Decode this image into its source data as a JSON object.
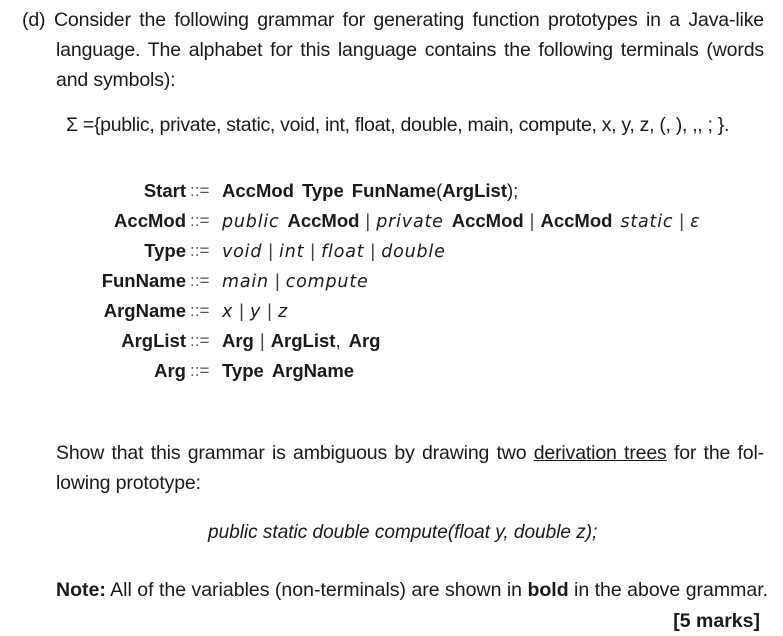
{
  "question": {
    "label": "(d)",
    "intro_lines": [
      "Consider the following grammar for generating function prototypes in a Java-like",
      "language.  The alphabet for this language contains the following terminals (words",
      "and symbols):"
    ],
    "alphabet": "Σ ={public, private, static, void, int, float, double, main, compute, x, y, z,  (,  ),  ,,  ;  }.",
    "grammar": {
      "operator": "::=",
      "rules": [
        {
          "lhs": "Start",
          "rhs": [
            {
              "text": "AccMod",
              "kind": "nt"
            },
            {
              "text": " ",
              "kind": "sp"
            },
            {
              "text": "Type",
              "kind": "nt"
            },
            {
              "text": " ",
              "kind": "sp"
            },
            {
              "text": "FunName",
              "kind": "nt"
            },
            {
              "text": "(",
              "kind": "plain"
            },
            {
              "text": "ArgList",
              "kind": "nt"
            },
            {
              "text": ");",
              "kind": "plain"
            }
          ]
        },
        {
          "lhs": "AccMod",
          "rhs": [
            {
              "text": "public",
              "kind": "t"
            },
            {
              "text": " ",
              "kind": "sp"
            },
            {
              "text": "AccMod",
              "kind": "nt"
            },
            {
              "text": "|",
              "kind": "bar"
            },
            {
              "text": "private",
              "kind": "t"
            },
            {
              "text": " ",
              "kind": "sp"
            },
            {
              "text": "AccMod",
              "kind": "nt"
            },
            {
              "text": "|",
              "kind": "bar"
            },
            {
              "text": "AccMod",
              "kind": "nt"
            },
            {
              "text": " ",
              "kind": "sp"
            },
            {
              "text": "static",
              "kind": "t"
            },
            {
              "text": "|",
              "kind": "bar"
            },
            {
              "text": "ε",
              "kind": "t"
            }
          ]
        },
        {
          "lhs": "Type",
          "rhs": [
            {
              "text": "void",
              "kind": "t"
            },
            {
              "text": "|",
              "kind": "bar"
            },
            {
              "text": "int",
              "kind": "t"
            },
            {
              "text": "|",
              "kind": "bar"
            },
            {
              "text": "float",
              "kind": "t"
            },
            {
              "text": "|",
              "kind": "bar"
            },
            {
              "text": "double",
              "kind": "t"
            }
          ]
        },
        {
          "lhs": "FunName",
          "rhs": [
            {
              "text": "main",
              "kind": "t"
            },
            {
              "text": "|",
              "kind": "bar"
            },
            {
              "text": "compute",
              "kind": "t"
            }
          ]
        },
        {
          "lhs": "ArgName",
          "rhs": [
            {
              "text": "x",
              "kind": "t"
            },
            {
              "text": "|",
              "kind": "bar"
            },
            {
              "text": "y",
              "kind": "t"
            },
            {
              "text": "|",
              "kind": "bar"
            },
            {
              "text": "z",
              "kind": "t"
            }
          ]
        },
        {
          "lhs": "ArgList",
          "rhs": [
            {
              "text": "Arg",
              "kind": "nt"
            },
            {
              "text": "|",
              "kind": "bar"
            },
            {
              "text": "ArgList",
              "kind": "nt"
            },
            {
              "text": ",",
              "kind": "plain"
            },
            {
              "text": " ",
              "kind": "sp"
            },
            {
              "text": "Arg",
              "kind": "nt"
            }
          ]
        },
        {
          "lhs": "Arg",
          "rhs": [
            {
              "text": "Type",
              "kind": "nt"
            },
            {
              "text": " ",
              "kind": "sp"
            },
            {
              "text": "ArgName",
              "kind": "nt"
            }
          ]
        }
      ]
    },
    "task": {
      "line1_before": "Show that this grammar is ambiguous by drawing two ",
      "line1_underlined": "derivation trees",
      "line1_after": " for the fol-",
      "line2": "lowing prototype:"
    },
    "prototype": "public static double compute(float y, double z);",
    "note": {
      "label": "Note:",
      "before": " All of the variables (non-terminals) are shown in ",
      "bold_word": "bold",
      "after": " in the above grammar."
    },
    "marks": "[5 marks]"
  }
}
